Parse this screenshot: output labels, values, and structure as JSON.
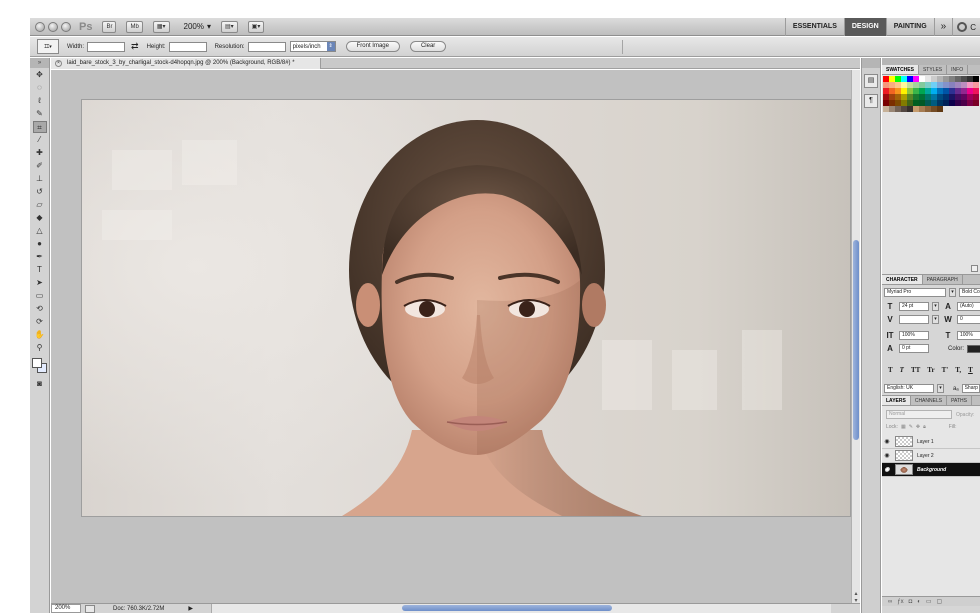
{
  "appbar": {
    "logo": "Ps",
    "bridge_label": "Br",
    "minibridge_label": "Mb",
    "zoom_value": "200%",
    "workspaces": [
      "ESSENTIALS",
      "DESIGN",
      "PAINTING"
    ],
    "active_workspace": "DESIGN",
    "more_label": "»",
    "cs_live_label": "C"
  },
  "options": {
    "width_label": "Width:",
    "width_value": "",
    "height_label": "Height:",
    "height_value": "",
    "resolution_label": "Resolution:",
    "resolution_value": "",
    "units_value": "pixels/inch",
    "front_image_label": "Front Image",
    "clear_label": "Clear"
  },
  "document": {
    "tab_title": "laid_bare_stock_3_by_charligal_stock-d4hopqn.jpg @ 200% (Background, RGB/8#) *",
    "zoom_field": "200%",
    "doc_size": "Doc: 760.3K/2.72M"
  },
  "swatches_panel": {
    "tabs": [
      "SWATCHES",
      "STYLES",
      "INFO"
    ],
    "active_tab": "SWATCHES",
    "colors": [
      "#ff0000",
      "#ffff00",
      "#00ff00",
      "#00ffff",
      "#0000ff",
      "#ff00ff",
      "#ffffff",
      "#e6e6e6",
      "#cccccc",
      "#b3b3b3",
      "#999999",
      "#808080",
      "#666666",
      "#4d4d4d",
      "#333333",
      "#000000",
      "#f7977a",
      "#f9ad81",
      "#fdc68a",
      "#fff79a",
      "#c4df9b",
      "#a2d39c",
      "#82ca9d",
      "#7bcdc8",
      "#6ecff6",
      "#7ea7d8",
      "#8493ca",
      "#8882be",
      "#a187be",
      "#bc8dbf",
      "#f49ac2",
      "#f6989d",
      "#ed1c24",
      "#f26522",
      "#f7941d",
      "#fff200",
      "#8dc63f",
      "#39b54a",
      "#00a651",
      "#00a99d",
      "#00aeef",
      "#0072bc",
      "#0054a6",
      "#2e3192",
      "#662d91",
      "#92278f",
      "#ec008c",
      "#ed145b",
      "#9e0b0f",
      "#a0410d",
      "#a36209",
      "#aba000",
      "#598527",
      "#1a7b30",
      "#007236",
      "#00746b",
      "#0076a3",
      "#004b80",
      "#003471",
      "#1b1464",
      "#440e62",
      "#630460",
      "#9e005d",
      "#9e0039",
      "#790000",
      "#7b2e00",
      "#7d4900",
      "#827b00",
      "#406618",
      "#005e20",
      "#005826",
      "#005952",
      "#005b7f",
      "#003663",
      "#002157",
      "#0d004c",
      "#32004b",
      "#4b0049",
      "#7b0046",
      "#7a0026",
      "#c7b299",
      "#998675",
      "#736357",
      "#534741",
      "#37302d",
      "#c69c6d",
      "#a67c52",
      "#8c6239",
      "#754c24",
      "#603913"
    ]
  },
  "character_panel": {
    "tabs": [
      "CHARACTER",
      "PARAGRAPH"
    ],
    "active_tab": "CHARACTER",
    "font_family": "Myriad Pro",
    "font_style": "Bold Co",
    "font_size": "24 pt",
    "leading": "(Auto)",
    "kerning": "",
    "tracking": "0",
    "vertical_scale": "100%",
    "horizontal_scale": "100%",
    "baseline_shift": "0 pt",
    "color_label": "Color:",
    "text_color": "#222222",
    "style_buttons": [
      "T",
      "T",
      "TT",
      "Tr",
      "T'",
      "T,",
      "T"
    ],
    "language": "English: UK",
    "antialias": "Sharp",
    "antialias_prefix": "aₐ"
  },
  "layers_panel": {
    "tabs": [
      "LAYERS",
      "CHANNELS",
      "PATHS"
    ],
    "active_tab": "LAYERS",
    "blend_mode": "Normal",
    "opacity_label": "Opacity:",
    "lock_label": "Lock:",
    "fill_label": "Fill:",
    "layers": [
      {
        "name": "Layer 1",
        "kind": "transparent",
        "selected": false
      },
      {
        "name": "Layer 2",
        "kind": "transparent",
        "selected": false
      },
      {
        "name": "Background",
        "kind": "photo",
        "selected": true
      }
    ]
  },
  "icons": {
    "tools": [
      "move-tool",
      "marquee-tool",
      "lasso-tool",
      "quick-select-tool",
      "crop-tool",
      "eyedropper-tool",
      "healing-brush-tool",
      "brush-tool",
      "clone-stamp-tool",
      "history-brush-tool",
      "eraser-tool",
      "paint-bucket-tool",
      "blur-tool",
      "dodge-tool",
      "pen-tool",
      "type-tool",
      "path-select-tool",
      "rectangle-tool",
      "3d-rotate-tool",
      "3d-orbit-tool",
      "hand-tool",
      "zoom-tool"
    ]
  }
}
